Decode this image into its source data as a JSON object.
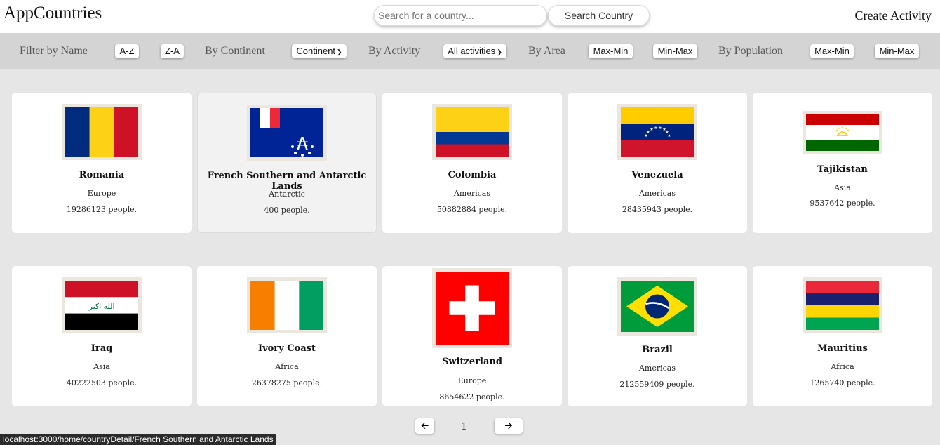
{
  "header": {
    "logo": "AppCountries",
    "search_placeholder": "Search for a country...",
    "search_button": "Search Country",
    "create_activity": "Create Activity"
  },
  "filters": {
    "by_name_label": "Filter by Name",
    "az": "A-Z",
    "za": "Z-A",
    "by_continent_label": "By Continent",
    "continent_select": "Continent",
    "by_activity_label": "By Activity",
    "activity_select": "All activities",
    "by_area_label": "By Area",
    "area_maxmin": "Max-Min",
    "area_minmax": "Min-Max",
    "by_population_label": "By Population",
    "pop_maxmin": "Max-Min",
    "pop_minmax": "Min-Max"
  },
  "countries": [
    {
      "name": "Romania",
      "continent": "Europe",
      "population": "19286123 people."
    },
    {
      "name": "French Southern and Antarctic Lands",
      "continent": "Antarctic",
      "population": "400 people."
    },
    {
      "name": "Colombia",
      "continent": "Americas",
      "population": "50882884 people."
    },
    {
      "name": "Venezuela",
      "continent": "Americas",
      "population": "28435943 people."
    },
    {
      "name": "Tajikistan",
      "continent": "Asia",
      "population": "9537642 people."
    },
    {
      "name": "Iraq",
      "continent": "Asia",
      "population": "40222503 people."
    },
    {
      "name": "Ivory Coast",
      "continent": "Africa",
      "population": "26378275 people."
    },
    {
      "name": "Switzerland",
      "continent": "Europe",
      "population": "8654622 people."
    },
    {
      "name": "Brazil",
      "continent": "Americas",
      "population": "212559409 people."
    },
    {
      "name": "Mauritius",
      "continent": "Africa",
      "population": "1265740 people."
    }
  ],
  "pagination": {
    "prev_icon": "arrow-left-icon",
    "page": "1",
    "next_icon": "arrow-right-icon"
  },
  "status_url": "localhost:3000/home/countryDetail/French Southern and Antarctic Lands",
  "iraq_flag_text": "الله اكبر"
}
